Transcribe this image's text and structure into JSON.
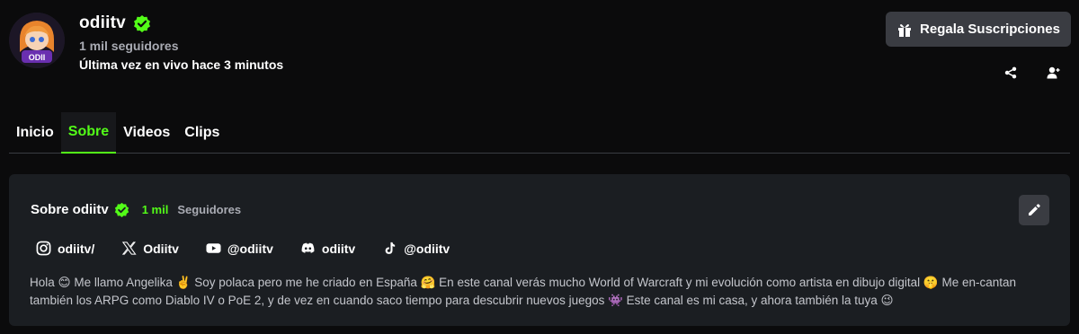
{
  "channel": {
    "name": "odiitv",
    "followers_text": "1 mil seguidores",
    "last_live": "Última vez en vivo hace 3 minutos",
    "avatar_label": "ODII"
  },
  "actions": {
    "gift_label": "Regala Suscripciones"
  },
  "tabs": [
    {
      "label": "Inicio",
      "active": false
    },
    {
      "label": "Sobre",
      "active": true
    },
    {
      "label": "Videos",
      "active": false
    },
    {
      "label": "Clips",
      "active": false
    }
  ],
  "about": {
    "title": "Sobre odiitv",
    "followers_count": "1 mil",
    "followers_label": "Seguidores",
    "socials": [
      {
        "icon": "instagram-icon",
        "label": "odiitv/"
      },
      {
        "icon": "x-icon",
        "label": "Odiitv"
      },
      {
        "icon": "youtube-icon",
        "label": "@odiitv"
      },
      {
        "icon": "discord-icon",
        "label": "odiitv"
      },
      {
        "icon": "tiktok-icon",
        "label": "@odiitv"
      }
    ],
    "bio": "Hola 😊 Me llamo Angelika ✌️ Soy polaca pero me he criado en España 🤗 En este canal verás mucho World of Warcraft y mi evolución como artista en dibujo digital 🤫 Me en-cantan también los ARPG como Diablo IV o PoE 2, y de vez en cuando saco tiempo para descubrir nuevos juegos 👾 Este canal es mi casa, y ahora también la tuya 😉"
  },
  "colors": {
    "accent": "#53fc18",
    "background": "#0b0b0c",
    "card": "#1b1e22",
    "button": "#3a3c42"
  }
}
